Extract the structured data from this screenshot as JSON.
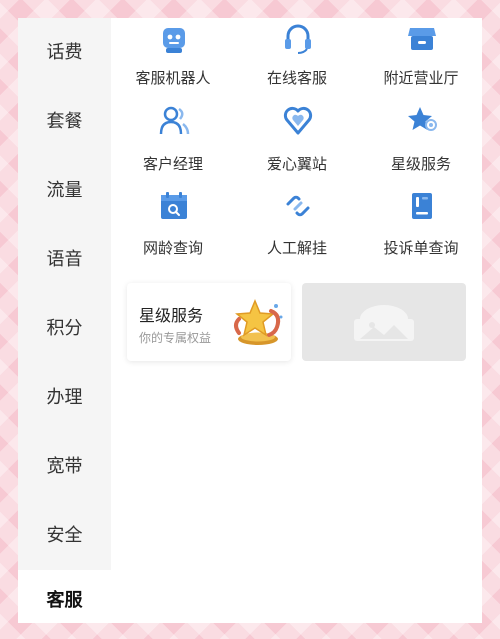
{
  "sidebar": {
    "items": [
      {
        "label": "话费"
      },
      {
        "label": "套餐"
      },
      {
        "label": "流量"
      },
      {
        "label": "语音"
      },
      {
        "label": "积分"
      },
      {
        "label": "办理"
      },
      {
        "label": "宽带"
      },
      {
        "label": "安全"
      }
    ],
    "active": {
      "label": "客服"
    }
  },
  "services": [
    {
      "label": "客服机器人",
      "icon": "robot-icon"
    },
    {
      "label": "在线客服",
      "icon": "headset-icon"
    },
    {
      "label": "附近营业厅",
      "icon": "store-icon"
    },
    {
      "label": "客户经理",
      "icon": "manager-icon"
    },
    {
      "label": "爱心翼站",
      "icon": "heart-location-icon"
    },
    {
      "label": "星级服务",
      "icon": "star-icon"
    },
    {
      "label": "网龄查询",
      "icon": "calendar-search-icon"
    },
    {
      "label": "人工解挂",
      "icon": "unlink-icon"
    },
    {
      "label": "投诉单查询",
      "icon": "document-icon"
    }
  ],
  "promo": {
    "title": "星级服务",
    "subtitle": "你的专属权益"
  },
  "colors": {
    "accent": "#3b82d6",
    "background": "#f7c9d3",
    "sidebar": "#f5f5f5"
  }
}
